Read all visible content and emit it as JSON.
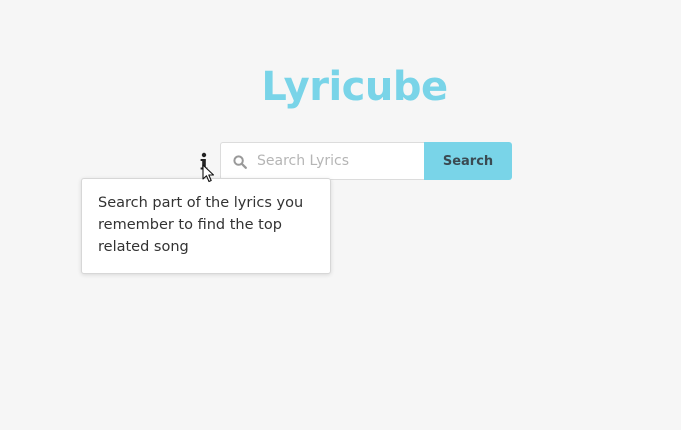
{
  "app": {
    "title": "Lyricube"
  },
  "search": {
    "placeholder": "Search Lyrics",
    "value": "",
    "button_label": "Search"
  },
  "tooltip": {
    "text": "Search part of the lyrics you remember to find the top related song"
  },
  "icons": {
    "info": "info-icon",
    "search": "search-icon",
    "cursor": "mouse-pointer-icon"
  },
  "colors": {
    "accent": "#79d4e8",
    "background": "#f6f6f6",
    "button_text": "#3a4a52"
  }
}
